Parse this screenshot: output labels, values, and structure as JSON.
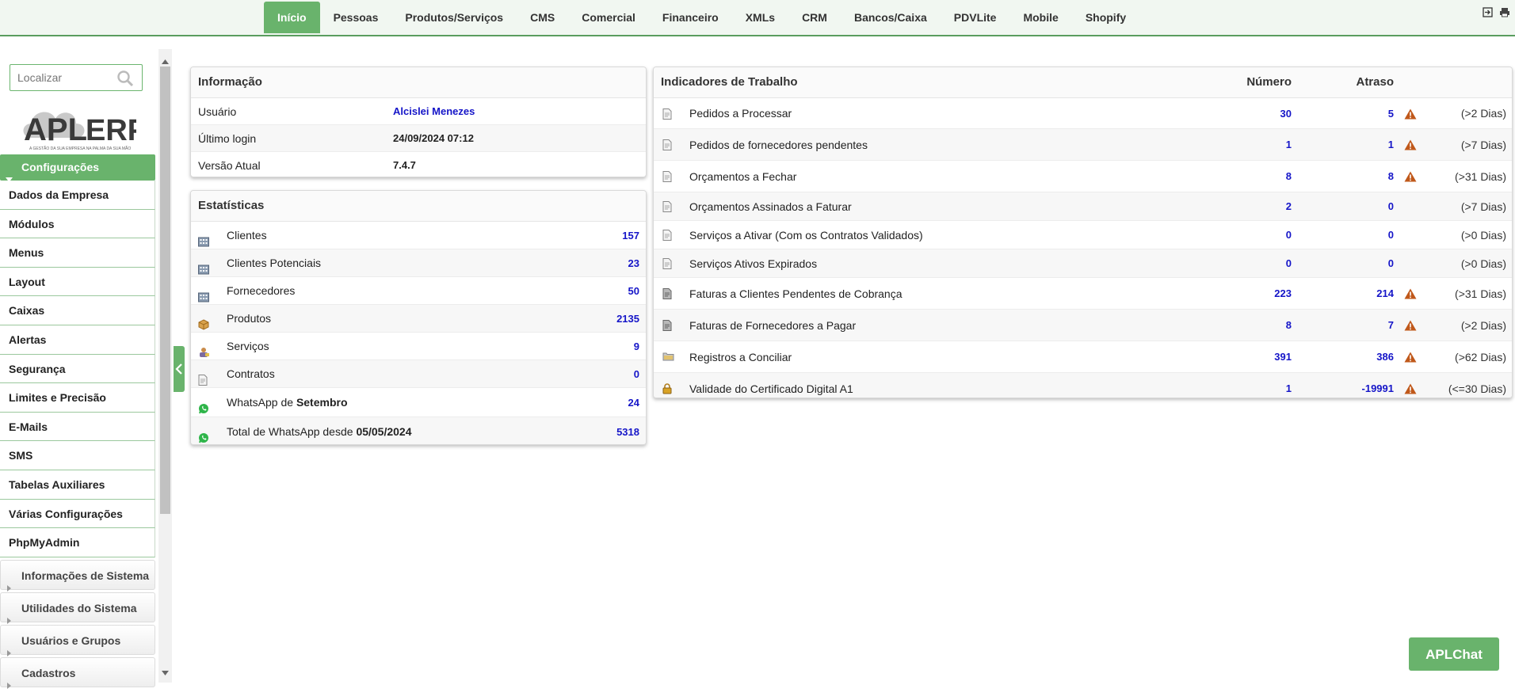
{
  "topnav": {
    "tabs": [
      "Início",
      "Pessoas",
      "Produtos/Serviços",
      "CMS",
      "Comercial",
      "Financeiro",
      "XMLs",
      "CRM",
      "Bancos/Caixa",
      "PDVLite",
      "Mobile",
      "Shopify"
    ],
    "active_index": 0,
    "icons": [
      "logout-icon",
      "print-icon"
    ]
  },
  "sidebar": {
    "search_placeholder": "Localizar",
    "logo": {
      "brand_left": "APL",
      "brand_right": "ERP",
      "tagline": "A GESTÃO DA SUA EMPRESA NA PALMA DA SUA MÃO"
    },
    "active_group": "Configurações",
    "items": [
      "Dados da Empresa",
      "Módulos",
      "Menus",
      "Layout",
      "Caixas",
      "Alertas",
      "Segurança",
      "Limites e Precisão",
      "E-Mails",
      "SMS",
      "Tabelas Auxiliares",
      "Várias Configurações",
      "PhpMyAdmin"
    ],
    "groups": [
      "Informações de Sistema",
      "Utilidades do Sistema",
      "Usuários e Grupos",
      "Cadastros"
    ]
  },
  "info": {
    "title": "Informação",
    "rows": [
      {
        "label": "Usuário",
        "value": "Alcislei Menezes"
      },
      {
        "label": "Último login",
        "value": "24/09/2024 07:12"
      },
      {
        "label": "Versão Atual",
        "value": "7.4.7"
      }
    ]
  },
  "stats": {
    "title": "Estatísticas",
    "rows": [
      {
        "icon": "building-icon",
        "label": "Clientes",
        "value": "157"
      },
      {
        "icon": "building-icon",
        "label": "Clientes Potenciais",
        "value": "23"
      },
      {
        "icon": "building-icon",
        "label": "Fornecedores",
        "value": "50"
      },
      {
        "icon": "box-icon",
        "label": "Produtos",
        "value": "2135"
      },
      {
        "icon": "service-icon",
        "label": "Serviços",
        "value": "9"
      },
      {
        "icon": "document-icon",
        "label": "Contratos",
        "value": "0"
      },
      {
        "icon": "whatsapp-icon",
        "label": "WhatsApp de ",
        "bold": "Setembro",
        "value": "24"
      },
      {
        "icon": "whatsapp-icon",
        "label": "Total de WhatsApp desde ",
        "bold": "05/05/2024",
        "value": "5318"
      }
    ]
  },
  "indicators": {
    "title": "Indicadores de Trabalho",
    "col_number": "Número",
    "col_delay": "Atraso",
    "rows": [
      {
        "icon": "document-icon",
        "label": "Pedidos a Processar",
        "number": "30",
        "delay": "5",
        "warning": true,
        "days": "(>2 Dias)"
      },
      {
        "icon": "document-icon",
        "label": "Pedidos de fornecedores pendentes",
        "number": "1",
        "delay": "1",
        "warning": true,
        "days": "(>7 Dias)"
      },
      {
        "icon": "document-icon",
        "label": "Orçamentos a Fechar",
        "number": "8",
        "delay": "8",
        "warning": true,
        "days": "(>31 Dias)"
      },
      {
        "icon": "document-icon",
        "label": "Orçamentos Assinados a Faturar",
        "number": "2",
        "delay": "0",
        "warning": false,
        "days": "(>7 Dias)"
      },
      {
        "icon": "document-icon",
        "label": "Serviços a Ativar (Com os Contratos Validados)",
        "number": "0",
        "delay": "0",
        "warning": false,
        "days": "(>0 Dias)"
      },
      {
        "icon": "document-icon",
        "label": "Serviços Ativos Expirados",
        "number": "0",
        "delay": "0",
        "warning": false,
        "days": "(>0 Dias)"
      },
      {
        "icon": "invoice-icon",
        "label": "Faturas a Clientes Pendentes de Cobrança",
        "number": "223",
        "delay": "214",
        "warning": true,
        "days": "(>31 Dias)"
      },
      {
        "icon": "invoice-icon",
        "label": "Faturas de Fornecedores a Pagar",
        "number": "8",
        "delay": "7",
        "warning": true,
        "days": "(>2 Dias)"
      },
      {
        "icon": "folder-icon",
        "label": "Registros a Conciliar",
        "number": "391",
        "delay": "386",
        "warning": true,
        "days": "(>62 Dias)"
      },
      {
        "icon": "lock-icon",
        "label": "Validade do Certificado Digital A1",
        "number": "1",
        "delay": "-19991",
        "warning": true,
        "days": "(<=30 Dias)"
      }
    ]
  },
  "chat_button": "APLChat",
  "colors": {
    "accent": "#69b36c",
    "link_blue": "#1515c8",
    "warning": "#c0581a"
  }
}
